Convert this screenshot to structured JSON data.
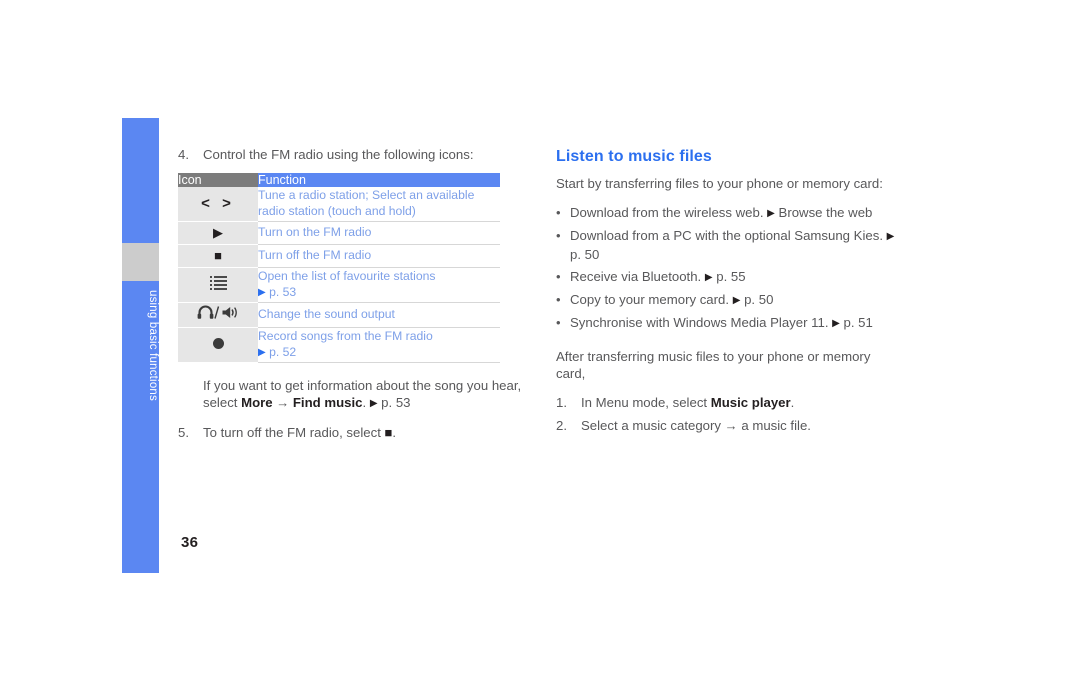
{
  "sidebar": {
    "label": "using basic functions",
    "color_blue": "#5b87f2",
    "color_gray": "#cccccc"
  },
  "page_number": "36",
  "left_column": {
    "step4": {
      "number": "4.",
      "text": "Control the FM radio using the following icons:"
    },
    "table": {
      "headers": [
        "Icon",
        "Function"
      ],
      "rows": [
        {
          "icon_name": "prev-next-icon",
          "icon_glyph": "< >",
          "function": "Tune a radio station; Select an available radio station (touch and hold)",
          "page_ref": ""
        },
        {
          "icon_name": "play-icon",
          "icon_glyph": "▶",
          "function": "Turn on the FM radio",
          "page_ref": ""
        },
        {
          "icon_name": "stop-icon",
          "icon_glyph": "■",
          "function": "Turn off the FM radio",
          "page_ref": ""
        },
        {
          "icon_name": "list-icon",
          "icon_glyph": "",
          "function": "Open the list of favourite stations",
          "page_ref": "p. 53"
        },
        {
          "icon_name": "headphone-speaker-icon",
          "icon_glyph": "∩/◀)",
          "function": "Change the sound output",
          "page_ref": ""
        },
        {
          "icon_name": "record-icon",
          "icon_glyph": "●",
          "function": "Record songs from the FM radio",
          "page_ref": "p. 52"
        }
      ]
    },
    "note": {
      "part1": "If you want to get information about the song you hear, select ",
      "bold1": "More",
      "arrow": " → ",
      "bold2": "Find music",
      "part2": ". ",
      "ref_marker": "▶",
      "ref_page": " p. 53"
    },
    "step5": {
      "number": "5.",
      "text_before": "To turn off the FM radio, select ",
      "icon_glyph": "■",
      "text_after": "."
    }
  },
  "right_column": {
    "heading": "Listen to music files",
    "heading_color": "#2b6fef",
    "intro": "Start by transferring files to your phone or memory card:",
    "bullets": [
      {
        "text_before": "Download from the wireless web. ",
        "marker": "▶",
        "text_after": " Browse the web"
      },
      {
        "text_before": "Download from a PC with the optional Samsung Kies. ",
        "marker": "▶",
        "text_after": " p. 50"
      },
      {
        "text_before": "Receive via Bluetooth. ",
        "marker": "▶",
        "text_after": " p. 55"
      },
      {
        "text_before": "Copy to your memory card. ",
        "marker": "▶",
        "text_after": " p. 50"
      },
      {
        "text_before": "Synchronise with Windows Media Player 11. ",
        "marker": "▶",
        "text_after": " p. 51"
      }
    ],
    "after_text": "After transferring music files to your phone or memory card,",
    "steps": [
      {
        "number": "1.",
        "text_before": "In Menu mode, select ",
        "bold": "Music player",
        "text_after": "."
      },
      {
        "number": "2.",
        "text_before": "Select a music category ",
        "bold": "",
        "arrow": "→",
        "text_after": " a music file."
      }
    ]
  }
}
